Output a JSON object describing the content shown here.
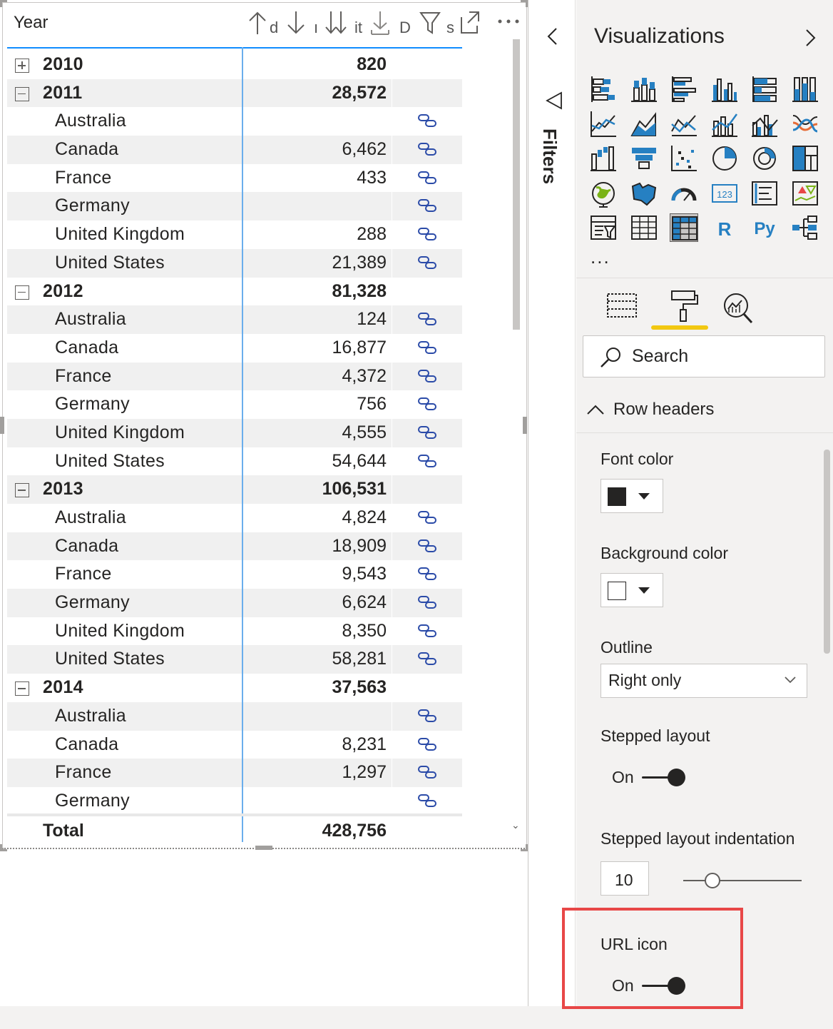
{
  "matrix": {
    "row_header_label": "Year",
    "toolbar_fragments": [
      "d",
      "ı",
      "it",
      "D",
      "s"
    ],
    "rows": [
      {
        "kind": "year",
        "expander": "plus",
        "label": "2010",
        "value": "820",
        "url": false
      },
      {
        "kind": "year",
        "expander": "minus",
        "label": "2011",
        "value": "28,572",
        "url": false
      },
      {
        "kind": "country",
        "label": "Australia",
        "value": "",
        "url": true
      },
      {
        "kind": "country",
        "label": "Canada",
        "value": "6,462",
        "url": true
      },
      {
        "kind": "country",
        "label": "France",
        "value": "433",
        "url": true
      },
      {
        "kind": "country",
        "label": "Germany",
        "value": "",
        "url": true
      },
      {
        "kind": "country",
        "label": "United Kingdom",
        "value": "288",
        "url": true
      },
      {
        "kind": "country",
        "label": "United States",
        "value": "21,389",
        "url": true
      },
      {
        "kind": "year",
        "expander": "minus",
        "label": "2012",
        "value": "81,328",
        "url": false
      },
      {
        "kind": "country",
        "label": "Australia",
        "value": "124",
        "url": true
      },
      {
        "kind": "country",
        "label": "Canada",
        "value": "16,877",
        "url": true
      },
      {
        "kind": "country",
        "label": "France",
        "value": "4,372",
        "url": true
      },
      {
        "kind": "country",
        "label": "Germany",
        "value": "756",
        "url": true
      },
      {
        "kind": "country",
        "label": "United Kingdom",
        "value": "4,555",
        "url": true
      },
      {
        "kind": "country",
        "label": "United States",
        "value": "54,644",
        "url": true
      },
      {
        "kind": "year",
        "expander": "minus",
        "label": "2013",
        "value": "106,531",
        "url": false
      },
      {
        "kind": "country",
        "label": "Australia",
        "value": "4,824",
        "url": true
      },
      {
        "kind": "country",
        "label": "Canada",
        "value": "18,909",
        "url": true
      },
      {
        "kind": "country",
        "label": "France",
        "value": "9,543",
        "url": true
      },
      {
        "kind": "country",
        "label": "Germany",
        "value": "6,624",
        "url": true
      },
      {
        "kind": "country",
        "label": "United Kingdom",
        "value": "8,350",
        "url": true
      },
      {
        "kind": "country",
        "label": "United States",
        "value": "58,281",
        "url": true
      },
      {
        "kind": "year",
        "expander": "minus",
        "label": "2014",
        "value": "37,563",
        "url": false
      },
      {
        "kind": "country",
        "label": "Australia",
        "value": "",
        "url": true
      },
      {
        "kind": "country",
        "label": "Canada",
        "value": "8,231",
        "url": true
      },
      {
        "kind": "country",
        "label": "France",
        "value": "1,297",
        "url": true
      },
      {
        "kind": "country",
        "label": "Germany",
        "value": "",
        "url": true
      }
    ],
    "total": {
      "label": "Total",
      "value": "428,756"
    },
    "link_icon_color": "#2b4ba8",
    "accent_color": "#118dff"
  },
  "filters_pane": {
    "label": "Filters"
  },
  "visualizations": {
    "title": "Visualizations",
    "more": "...",
    "icons": [
      "stacked-bar-chart",
      "stacked-column-chart",
      "clustered-bar-chart",
      "clustered-column-chart",
      "100-stacked-bar-chart",
      "100-stacked-column-chart",
      "line-chart",
      "area-chart",
      "stacked-area-chart",
      "line-and-stacked-column-chart",
      "line-and-clustered-column-chart",
      "ribbon-chart",
      "waterfall-chart",
      "funnel-chart",
      "scatter-chart",
      "pie-chart",
      "donut-chart",
      "treemap",
      "map",
      "filled-map",
      "gauge",
      "card",
      "multi-row-card",
      "kpi",
      "slicer",
      "table",
      "matrix",
      "r-script-visual",
      "python-visual",
      "decomposition-tree"
    ],
    "selected_icon": "matrix",
    "r_label": "R",
    "py_label": "Py",
    "card_label": "123",
    "tabs": [
      "fields-tab",
      "format-tab",
      "analytics-tab"
    ],
    "active_tab": "format-tab",
    "search_placeholder": "Search",
    "section_title": "Row headers",
    "font_color_label": "Font color",
    "font_color_value": "#252423",
    "background_color_label": "Background color",
    "background_color_value": "#ffffff",
    "outline_label": "Outline",
    "outline_value": "Right only",
    "stepped_layout_label": "Stepped layout",
    "stepped_layout_state": "On",
    "stepped_indent_label": "Stepped layout indentation",
    "stepped_indent_value": "10",
    "url_icon_label": "URL icon",
    "url_icon_state": "On",
    "highlight_color": "#e84747"
  }
}
